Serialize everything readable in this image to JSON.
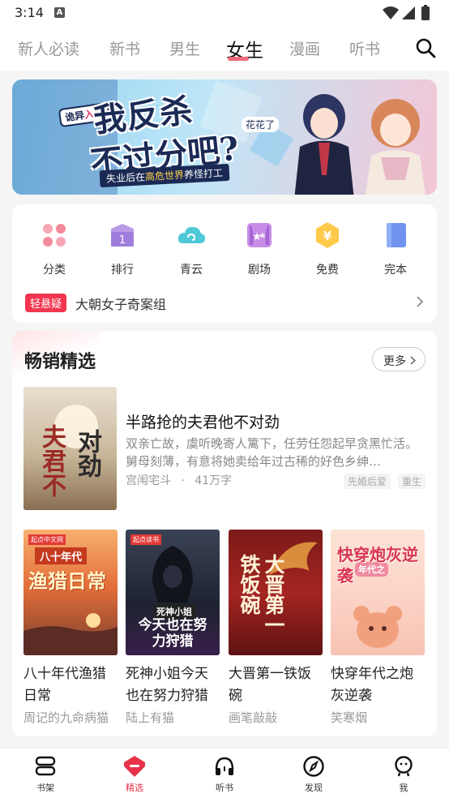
{
  "status_bar": {
    "time": "3:14",
    "notif_glyph": "A"
  },
  "top_tabs": [
    {
      "label": "新人必读"
    },
    {
      "label": "新书"
    },
    {
      "label": "男生"
    },
    {
      "label": "女生",
      "active": true
    },
    {
      "label": "漫画"
    },
    {
      "label": "听书"
    }
  ],
  "banner": {
    "tag_prefix": "诡异",
    "tag_suffix": "入侵",
    "title_line1": "我反杀",
    "title_line2": "不过分吧?",
    "author": "花花了",
    "slogan_a": "失业后在",
    "slogan_b": "高危世界",
    "slogan_c": "养怪打工"
  },
  "categories": [
    {
      "label": "分类",
      "icon": "flower-grid-icon"
    },
    {
      "label": "排行",
      "icon": "rank-one-icon"
    },
    {
      "label": "青云",
      "icon": "cloud-icon"
    },
    {
      "label": "剧场",
      "icon": "theater-icon"
    },
    {
      "label": "免费",
      "icon": "yen-hexagon-icon"
    },
    {
      "label": "完本",
      "icon": "closed-book-icon"
    }
  ],
  "promo": {
    "badge": "轻悬疑",
    "title": "大朝女子奇案组"
  },
  "bestseller": {
    "title": "畅销精选",
    "more_label": "更多",
    "featured": {
      "cover_text_a": "夫君不",
      "cover_text_b": "对劲",
      "title": "半路抢的夫君他不对劲",
      "description": "双亲亡故，虞听晚寄人篱下，任劳任怨起早贪黑忙活。舅母刻薄，有意将她卖给年过古稀的好色乡绅…",
      "genre": "宫闱宅斗",
      "separator": "·",
      "word_count": "41万字",
      "tags": [
        "先婚后爱",
        "重生"
      ]
    },
    "books": [
      {
        "title": "八十年代渔猎日常",
        "author": "周记的九命病猫",
        "cover_text": "渔猎日常",
        "cover_sub": "八十年代",
        "brand": "起点中文网"
      },
      {
        "title": "死神小姐今天也在努力狩猎",
        "author": "陆上有猫",
        "cover_text": "今天也在努力狩猎",
        "cover_sub": "死神小姐",
        "brand": "起点读书"
      },
      {
        "title": "大晋第一铁饭碗",
        "author": "画笔敲敲",
        "cover_text": "大晋第一铁饭碗",
        "cover_sub": "",
        "brand": ""
      },
      {
        "title": "快穿年代之炮灰逆袭",
        "author": "笑寒烟",
        "cover_text": "快穿炮灰逆袭",
        "cover_sub": "年代之",
        "brand": ""
      }
    ]
  },
  "bottom_nav": [
    {
      "label": "书架",
      "icon": "bookshelf-icon"
    },
    {
      "label": "精选",
      "icon": "featured-gem-icon",
      "active": true
    },
    {
      "label": "听书",
      "icon": "headphones-icon"
    },
    {
      "label": "发现",
      "icon": "compass-icon"
    },
    {
      "label": "我",
      "icon": "user-face-icon"
    }
  ],
  "colors": {
    "accent": "#e8334a",
    "promo_badge": "#f2364e",
    "tab_underline": "#f26a7a"
  }
}
